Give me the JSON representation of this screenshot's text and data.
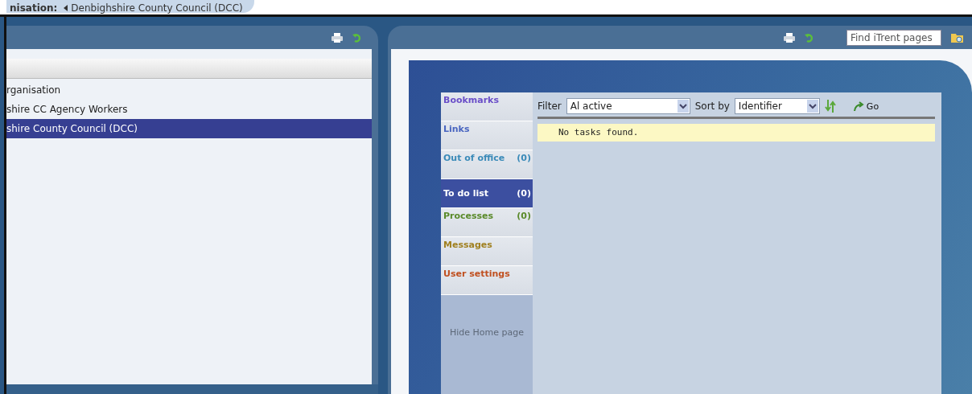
{
  "header": {
    "label": "nisation:",
    "value": "Denbighshire County Council (DCC)"
  },
  "left_panel": {
    "rows": [
      {
        "label": "rganisation",
        "selected": false
      },
      {
        "label": "shire CC Agency Workers",
        "selected": false
      },
      {
        "label": "shire County Council (DCC)",
        "selected": true
      }
    ]
  },
  "right_panel": {
    "search": {
      "placeholder": "Find iTrent pages"
    },
    "nav": [
      {
        "label": "Bookmarks",
        "color": "#6a4fc8",
        "selected": false
      },
      {
        "label": "Links",
        "color": "#4a66c0",
        "selected": false
      },
      {
        "label": "Out of office",
        "count": "(0)",
        "color": "#3a8ab8",
        "selected": false
      },
      {
        "label": "To do list",
        "count": "(0)",
        "color": "#ffffff",
        "selected": true
      },
      {
        "label": "Processes",
        "count": "(0)",
        "color": "#5a8a2a",
        "selected": false
      },
      {
        "label": "Messages",
        "color": "#a08020",
        "selected": false
      },
      {
        "label": "User settings",
        "color": "#c05020",
        "selected": false
      }
    ],
    "hide_link": "Hide Home page",
    "toolbar": {
      "filter_label": "Filter",
      "filter_value": "Al active",
      "sort_label": "Sort by",
      "sort_value": "Identifier",
      "go": "Go"
    },
    "message": "No tasks found."
  }
}
